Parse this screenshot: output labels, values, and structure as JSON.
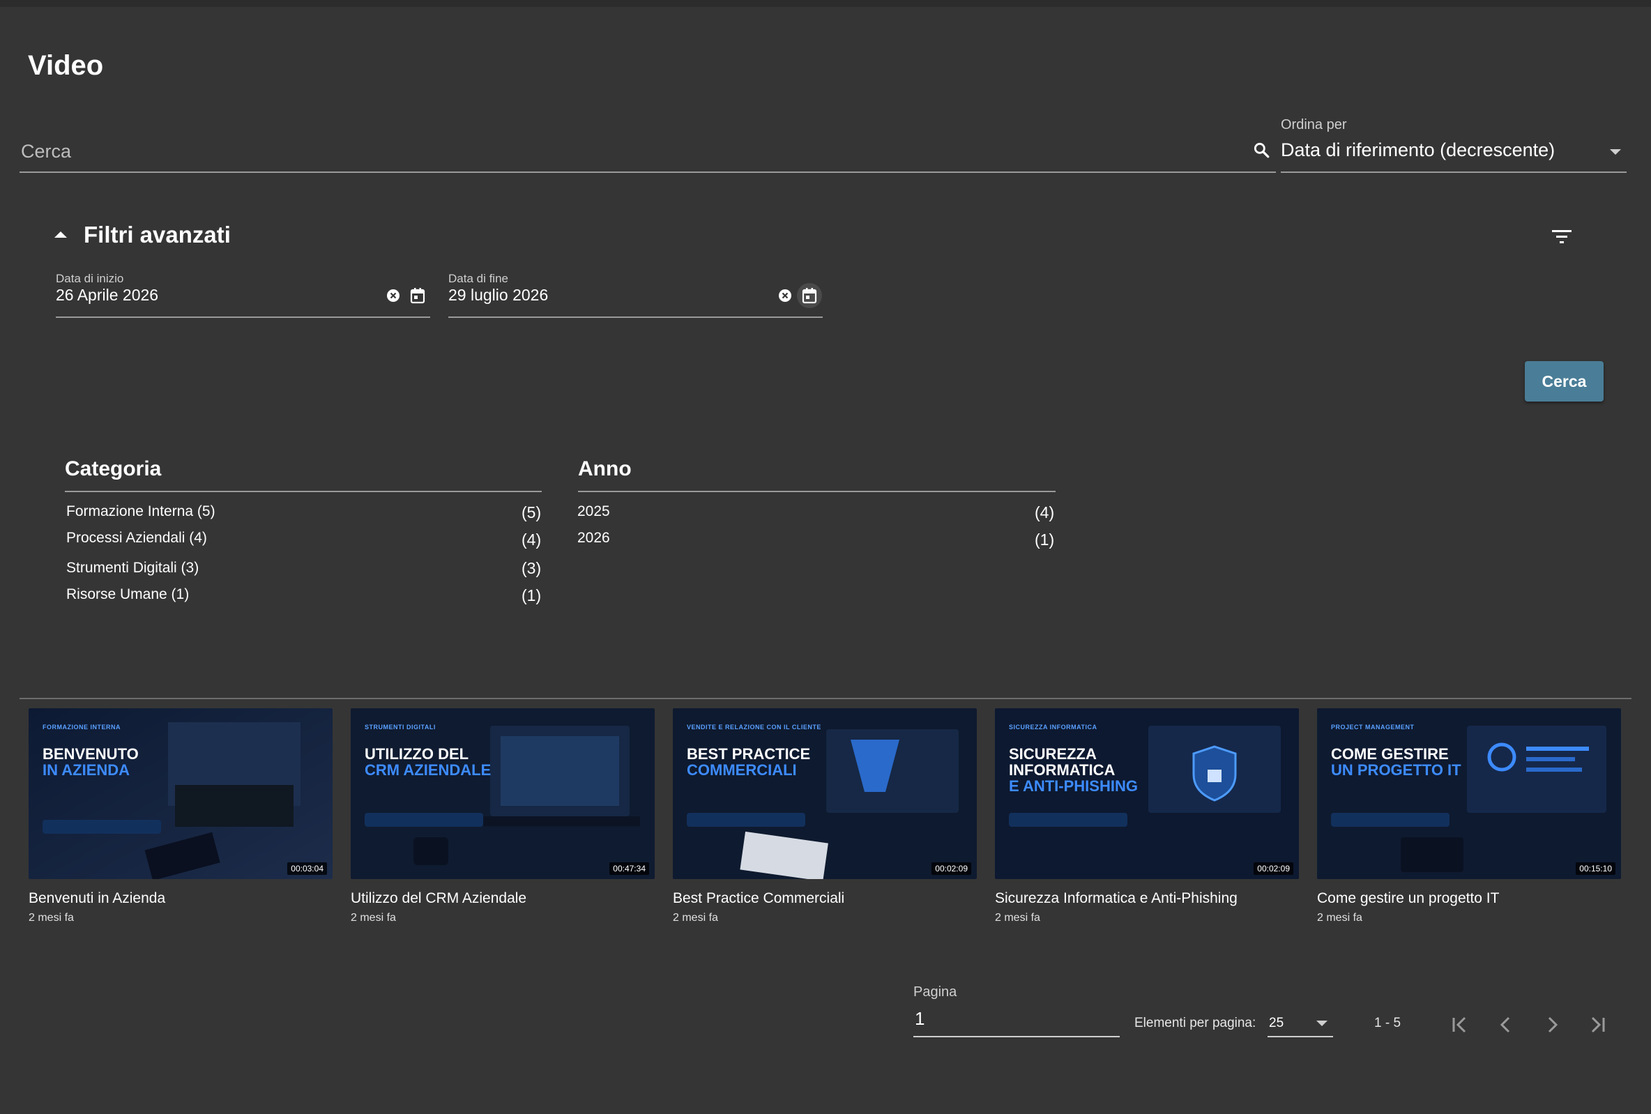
{
  "page": {
    "title": "Video"
  },
  "search": {
    "placeholder": "Cerca"
  },
  "sort": {
    "label": "Ordina per",
    "value": "Data di riferimento (decrescente)"
  },
  "filters": {
    "title": "Filtri avanzati",
    "start_date": {
      "label": "Data di inizio",
      "value": "26 Aprile 2026"
    },
    "end_date": {
      "label": "Data di fine",
      "value": "29 luglio 2026"
    },
    "search_button": "Cerca"
  },
  "facets": {
    "category": {
      "title": "Categoria",
      "items": [
        {
          "label": "Formazione Interna (5)",
          "count": "(5)"
        },
        {
          "label": "Processi Aziendali (4)",
          "count": "(4)"
        },
        {
          "label": "Strumenti Digitali (3)",
          "count": "(3)"
        },
        {
          "label": "Risorse Umane (1)",
          "count": "(1)"
        }
      ]
    },
    "year": {
      "title": "Anno",
      "items": [
        {
          "label": "2025",
          "count": "(4)"
        },
        {
          "label": "2026",
          "count": "(1)"
        }
      ]
    }
  },
  "videos": [
    {
      "title": "Benvenuti in Azienda",
      "meta": "2 mesi fa",
      "duration": "00:03:04",
      "kicker": "FORMAZIONE INTERNA",
      "headline": "BENVENUTO",
      "headline_accent": "IN AZIENDA"
    },
    {
      "title": "Utilizzo del CRM Aziendale",
      "meta": "2 mesi fa",
      "duration": "00:47:34",
      "kicker": "STRUMENTI DIGITALI",
      "headline": "UTILIZZO DEL",
      "headline_accent": "CRM AZIENDALE"
    },
    {
      "title": "Best Practice Commerciali",
      "meta": "2 mesi fa",
      "duration": "00:02:09",
      "kicker": "VENDITE E RELAZIONE CON IL CLIENTE",
      "headline": "BEST PRACTICE",
      "headline_accent": "COMMERCIALI"
    },
    {
      "title": "Sicurezza Informatica e Anti-Phishing",
      "meta": "2 mesi fa",
      "duration": "00:02:09",
      "kicker": "SICUREZZA INFORMATICA",
      "headline": "SICUREZZA INFORMATICA",
      "headline_accent": "E ANTI-PHISHING"
    },
    {
      "title": "Come gestire un progetto IT",
      "meta": "2 mesi fa",
      "duration": "00:15:10",
      "kicker": "PROJECT MANAGEMENT",
      "headline": "COME GESTIRE",
      "headline_accent": "UN PROGETTO IT"
    }
  ],
  "pagination": {
    "page_label": "Pagina",
    "page_value": "1",
    "per_page_label": "Elementi per pagina:",
    "per_page_value": "25",
    "range": "1 - 5"
  },
  "icons": {
    "search": "search-icon",
    "filter": "filter-list-icon",
    "clear": "clear-circle-icon",
    "calendar": "calendar-icon",
    "first_page": "first-page-icon",
    "prev_page": "chevron-left-icon",
    "next_page": "chevron-right-icon",
    "last_page": "last-page-icon"
  },
  "colors": {
    "background": "#353535",
    "primary_button": "#4a7d97",
    "accent": "#3d8bff"
  }
}
